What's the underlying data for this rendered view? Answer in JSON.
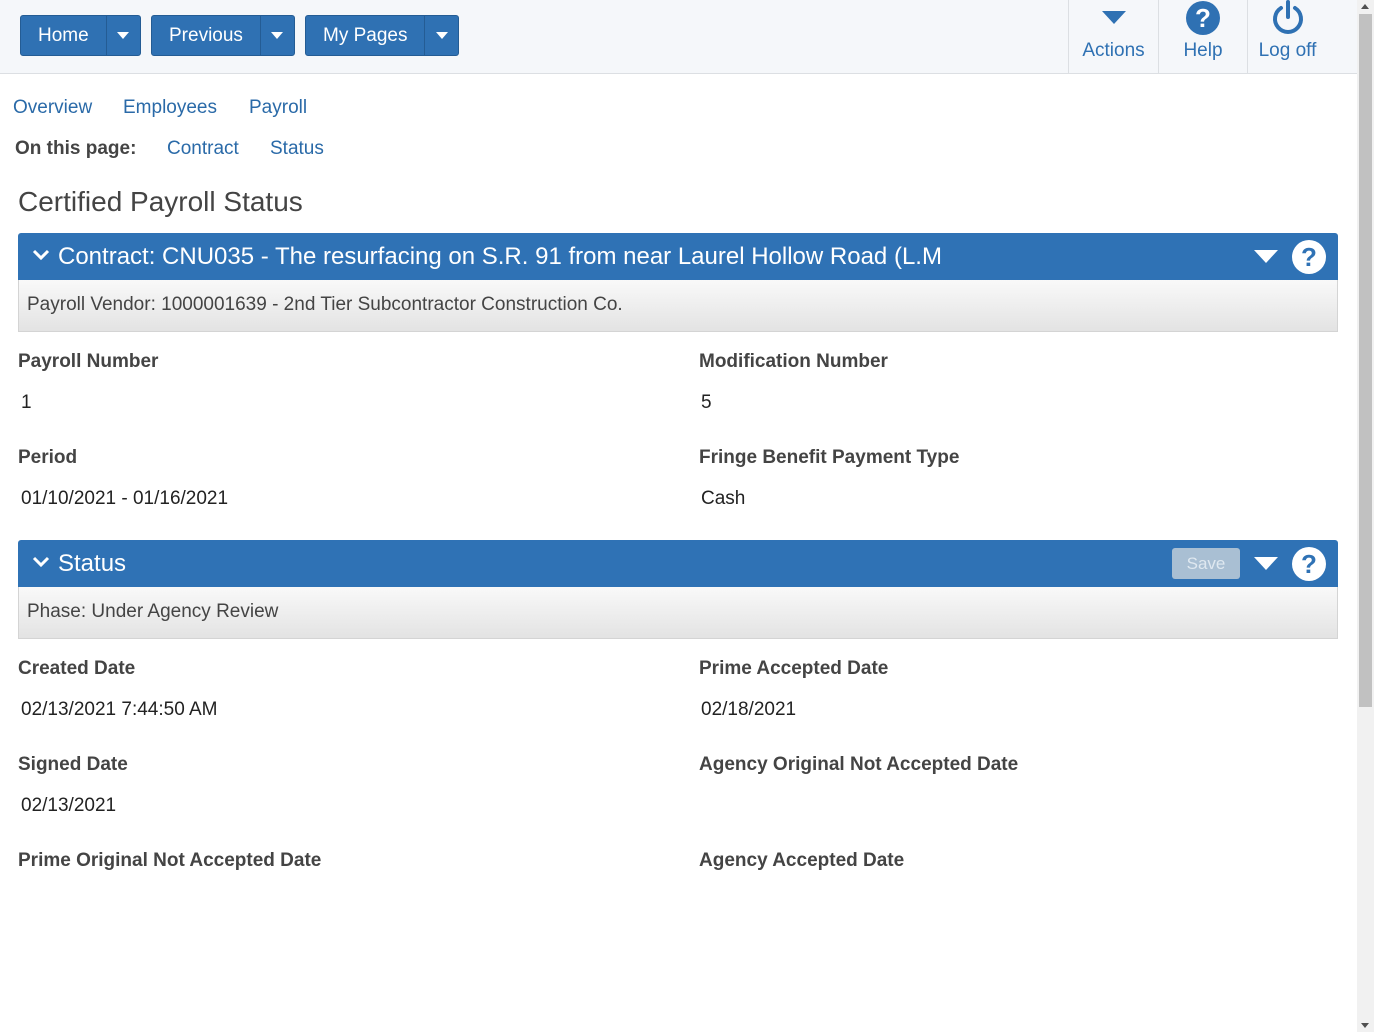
{
  "topnav": {
    "buttons": [
      {
        "label": "Home"
      },
      {
        "label": "Previous"
      },
      {
        "label": "My Pages"
      }
    ],
    "tools": {
      "actions": "Actions",
      "help": "Help",
      "logoff": "Log off"
    }
  },
  "tabs": [
    "Overview",
    "Employees",
    "Payroll"
  ],
  "on_this_page": {
    "label": "On this page:",
    "links": [
      "Contract",
      "Status"
    ]
  },
  "page_title": "Certified Payroll Status",
  "contract_panel": {
    "header": "Contract: CNU035 - The resurfacing on S.R. 91 from near Laurel Hollow Road (L.M",
    "subheader": "Payroll Vendor: 1000001639 - 2nd Tier Subcontractor Construction Co.",
    "fields": {
      "payroll_number_label": "Payroll Number",
      "payroll_number": "1",
      "modification_number_label": "Modification Number",
      "modification_number": "5",
      "period_label": "Period",
      "period": "01/10/2021 - 01/16/2021",
      "fringe_label": "Fringe Benefit Payment Type",
      "fringe": "Cash"
    }
  },
  "status_panel": {
    "header": "Status",
    "save_label": "Save",
    "subheader": "Phase: Under Agency Review",
    "fields": {
      "created_label": "Created Date",
      "created": "02/13/2021 7:44:50 AM",
      "prime_accepted_label": "Prime Accepted Date",
      "prime_accepted": "02/18/2021",
      "signed_label": "Signed Date",
      "signed": "02/13/2021",
      "agency_orig_not_accepted_label": "Agency Original Not Accepted Date",
      "prime_orig_not_accepted_label": "Prime Original Not Accepted Date",
      "agency_accepted_label": "Agency Accepted Date"
    }
  },
  "colors": {
    "primary": "#2f72b5",
    "link": "#2a6aa8"
  }
}
